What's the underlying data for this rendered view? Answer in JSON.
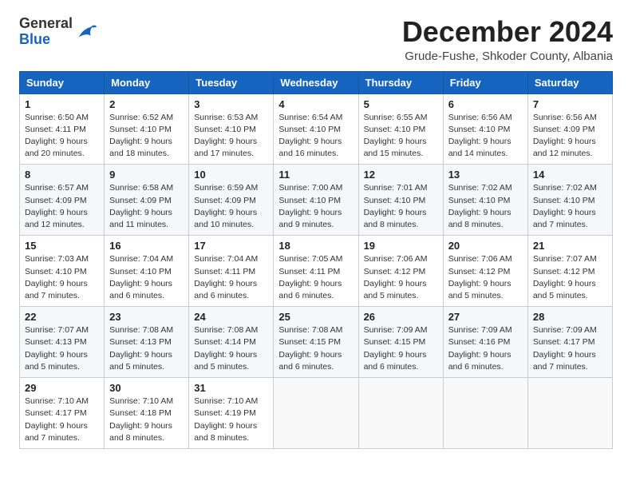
{
  "header": {
    "logo_general": "General",
    "logo_blue": "Blue",
    "month_title": "December 2024",
    "subtitle": "Grude-Fushe, Shkoder County, Albania"
  },
  "weekdays": [
    "Sunday",
    "Monday",
    "Tuesday",
    "Wednesday",
    "Thursday",
    "Friday",
    "Saturday"
  ],
  "weeks": [
    [
      {
        "day": "1",
        "info": "Sunrise: 6:50 AM\nSunset: 4:11 PM\nDaylight: 9 hours\nand 20 minutes."
      },
      {
        "day": "2",
        "info": "Sunrise: 6:52 AM\nSunset: 4:10 PM\nDaylight: 9 hours\nand 18 minutes."
      },
      {
        "day": "3",
        "info": "Sunrise: 6:53 AM\nSunset: 4:10 PM\nDaylight: 9 hours\nand 17 minutes."
      },
      {
        "day": "4",
        "info": "Sunrise: 6:54 AM\nSunset: 4:10 PM\nDaylight: 9 hours\nand 16 minutes."
      },
      {
        "day": "5",
        "info": "Sunrise: 6:55 AM\nSunset: 4:10 PM\nDaylight: 9 hours\nand 15 minutes."
      },
      {
        "day": "6",
        "info": "Sunrise: 6:56 AM\nSunset: 4:10 PM\nDaylight: 9 hours\nand 14 minutes."
      },
      {
        "day": "7",
        "info": "Sunrise: 6:56 AM\nSunset: 4:09 PM\nDaylight: 9 hours\nand 12 minutes."
      }
    ],
    [
      {
        "day": "8",
        "info": "Sunrise: 6:57 AM\nSunset: 4:09 PM\nDaylight: 9 hours\nand 12 minutes."
      },
      {
        "day": "9",
        "info": "Sunrise: 6:58 AM\nSunset: 4:09 PM\nDaylight: 9 hours\nand 11 minutes."
      },
      {
        "day": "10",
        "info": "Sunrise: 6:59 AM\nSunset: 4:09 PM\nDaylight: 9 hours\nand 10 minutes."
      },
      {
        "day": "11",
        "info": "Sunrise: 7:00 AM\nSunset: 4:10 PM\nDaylight: 9 hours\nand 9 minutes."
      },
      {
        "day": "12",
        "info": "Sunrise: 7:01 AM\nSunset: 4:10 PM\nDaylight: 9 hours\nand 8 minutes."
      },
      {
        "day": "13",
        "info": "Sunrise: 7:02 AM\nSunset: 4:10 PM\nDaylight: 9 hours\nand 8 minutes."
      },
      {
        "day": "14",
        "info": "Sunrise: 7:02 AM\nSunset: 4:10 PM\nDaylight: 9 hours\nand 7 minutes."
      }
    ],
    [
      {
        "day": "15",
        "info": "Sunrise: 7:03 AM\nSunset: 4:10 PM\nDaylight: 9 hours\nand 7 minutes."
      },
      {
        "day": "16",
        "info": "Sunrise: 7:04 AM\nSunset: 4:10 PM\nDaylight: 9 hours\nand 6 minutes."
      },
      {
        "day": "17",
        "info": "Sunrise: 7:04 AM\nSunset: 4:11 PM\nDaylight: 9 hours\nand 6 minutes."
      },
      {
        "day": "18",
        "info": "Sunrise: 7:05 AM\nSunset: 4:11 PM\nDaylight: 9 hours\nand 6 minutes."
      },
      {
        "day": "19",
        "info": "Sunrise: 7:06 AM\nSunset: 4:12 PM\nDaylight: 9 hours\nand 5 minutes."
      },
      {
        "day": "20",
        "info": "Sunrise: 7:06 AM\nSunset: 4:12 PM\nDaylight: 9 hours\nand 5 minutes."
      },
      {
        "day": "21",
        "info": "Sunrise: 7:07 AM\nSunset: 4:12 PM\nDaylight: 9 hours\nand 5 minutes."
      }
    ],
    [
      {
        "day": "22",
        "info": "Sunrise: 7:07 AM\nSunset: 4:13 PM\nDaylight: 9 hours\nand 5 minutes."
      },
      {
        "day": "23",
        "info": "Sunrise: 7:08 AM\nSunset: 4:13 PM\nDaylight: 9 hours\nand 5 minutes."
      },
      {
        "day": "24",
        "info": "Sunrise: 7:08 AM\nSunset: 4:14 PM\nDaylight: 9 hours\nand 5 minutes."
      },
      {
        "day": "25",
        "info": "Sunrise: 7:08 AM\nSunset: 4:15 PM\nDaylight: 9 hours\nand 6 minutes."
      },
      {
        "day": "26",
        "info": "Sunrise: 7:09 AM\nSunset: 4:15 PM\nDaylight: 9 hours\nand 6 minutes."
      },
      {
        "day": "27",
        "info": "Sunrise: 7:09 AM\nSunset: 4:16 PM\nDaylight: 9 hours\nand 6 minutes."
      },
      {
        "day": "28",
        "info": "Sunrise: 7:09 AM\nSunset: 4:17 PM\nDaylight: 9 hours\nand 7 minutes."
      }
    ],
    [
      {
        "day": "29",
        "info": "Sunrise: 7:10 AM\nSunset: 4:17 PM\nDaylight: 9 hours\nand 7 minutes."
      },
      {
        "day": "30",
        "info": "Sunrise: 7:10 AM\nSunset: 4:18 PM\nDaylight: 9 hours\nand 8 minutes."
      },
      {
        "day": "31",
        "info": "Sunrise: 7:10 AM\nSunset: 4:19 PM\nDaylight: 9 hours\nand 8 minutes."
      },
      {
        "day": "",
        "info": ""
      },
      {
        "day": "",
        "info": ""
      },
      {
        "day": "",
        "info": ""
      },
      {
        "day": "",
        "info": ""
      }
    ]
  ]
}
